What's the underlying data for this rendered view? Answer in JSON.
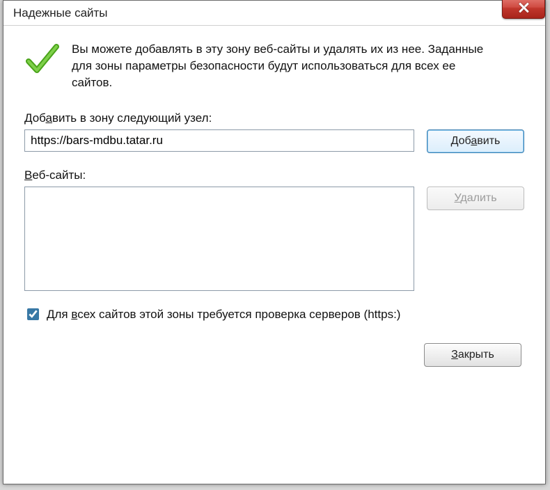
{
  "window": {
    "title": "Надежные сайты"
  },
  "intro": {
    "text": "Вы можете добавлять в эту зону веб-сайты и удалять их из нее. Заданные для зоны параметры безопасности будут использоваться для всех ее сайтов."
  },
  "add_section": {
    "label_pre": "Доб",
    "label_accel": "а",
    "label_post": "вить в зону следующий узел:",
    "input_value": "https://bars-mdbu.tatar.ru",
    "button_pre": "Доб",
    "button_accel": "а",
    "button_post": "вить"
  },
  "list_section": {
    "label_accel": "В",
    "label_post": "еб-сайты:",
    "remove_accel": "У",
    "remove_post": "далить"
  },
  "https_checkbox": {
    "checked": true,
    "label_pre": "Для ",
    "label_accel": "в",
    "label_post": "сех сайтов этой зоны требуется проверка серверов (https:)"
  },
  "footer": {
    "close_accel": "З",
    "close_post": "акрыть"
  }
}
